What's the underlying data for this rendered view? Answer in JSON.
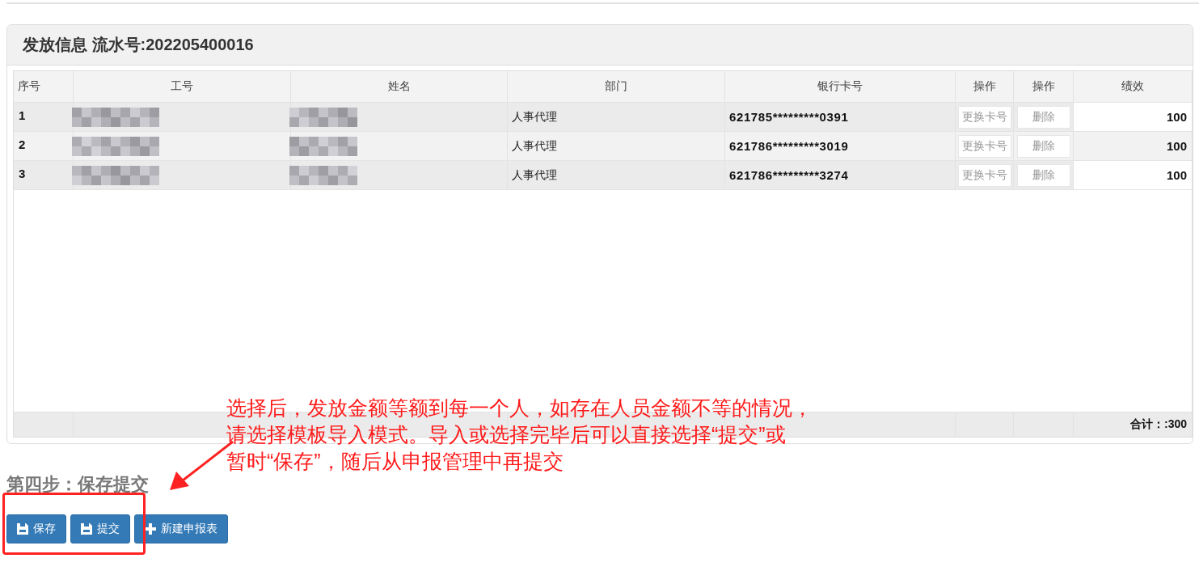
{
  "panel": {
    "title": "发放信息 流水号:202205400016",
    "table": {
      "columns": [
        "序号",
        "工号",
        "姓名",
        "部门",
        "银行卡号",
        "操作",
        "操作",
        "绩效"
      ],
      "rows": [
        {
          "index": "1",
          "employee_id_redacted": true,
          "name_redacted": true,
          "department": "人事代理",
          "bank_card": "621785*********0391",
          "actions": [
            "更换卡号",
            "删除"
          ],
          "performance": "100"
        },
        {
          "index": "2",
          "employee_id_redacted": true,
          "name_redacted": true,
          "department": "人事代理",
          "bank_card": "621786*********3019",
          "actions": [
            "更换卡号",
            "删除"
          ],
          "performance": "100"
        },
        {
          "index": "3",
          "employee_id_redacted": true,
          "name_redacted": true,
          "department": "人事代理",
          "bank_card": "621786*********3274",
          "actions": [
            "更换卡号",
            "删除"
          ],
          "performance": "100"
        }
      ],
      "footer": {
        "total": "合计：:300"
      }
    }
  },
  "step": {
    "heading": "第四步：保存提交",
    "buttons": [
      {
        "label": "保存",
        "kind": "save"
      },
      {
        "label": "提交",
        "kind": "save"
      },
      {
        "label": "新建申报表",
        "kind": "add"
      }
    ]
  },
  "annotation": {
    "lines": [
      "选择后，发放金额等额到每一个人，如存在人员金额不等的情况，",
      "请选择模板导入模式。导入或选择完毕后可以直接选择“提交”或",
      "暂时“保存”，随后从申报管理中再提交"
    ]
  }
}
